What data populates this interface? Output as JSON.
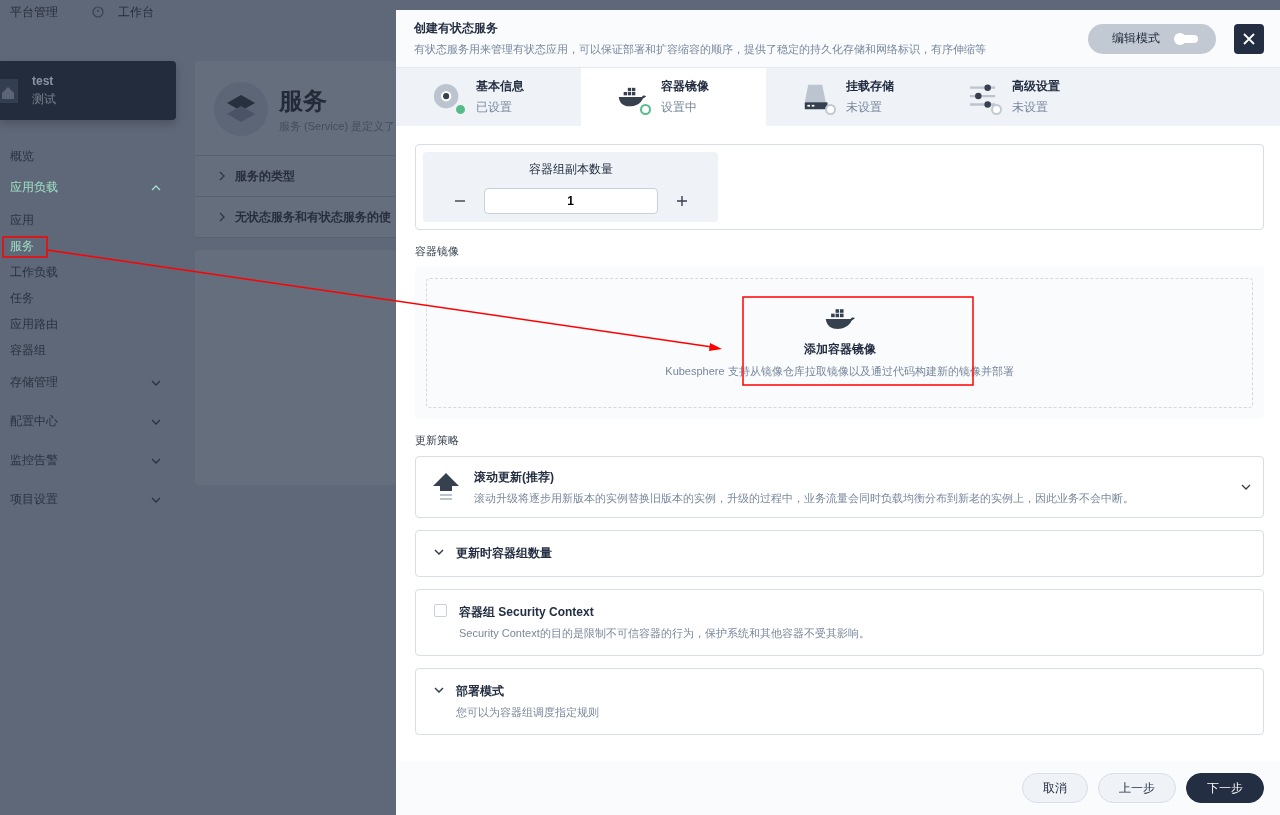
{
  "top_bar": {
    "items": [
      {
        "label": "平台管理",
        "kind": "text"
      },
      {
        "label": "工作台",
        "kind": "icon"
      }
    ]
  },
  "project": {
    "name": "test",
    "alias": "测试"
  },
  "nav": [
    {
      "label": "概览",
      "kind": "item",
      "selected": false
    },
    {
      "label": "应用负载",
      "kind": "group",
      "expanded": true,
      "selected": true,
      "children": [
        {
          "label": "应用",
          "selected": false
        },
        {
          "label": "服务",
          "selected": true
        },
        {
          "label": "工作负载",
          "selected": false
        },
        {
          "label": "任务",
          "selected": false
        },
        {
          "label": "应用路由",
          "selected": false
        },
        {
          "label": "容器组",
          "selected": false
        }
      ]
    },
    {
      "label": "存储管理",
      "kind": "group",
      "expanded": false,
      "selected": false
    },
    {
      "label": "配置中心",
      "kind": "group",
      "expanded": false,
      "selected": false
    },
    {
      "label": "监控告警",
      "kind": "group",
      "expanded": false,
      "selected": false
    },
    {
      "label": "项目设置",
      "kind": "group",
      "expanded": false,
      "selected": false
    }
  ],
  "page": {
    "title": "服务",
    "subtitle": "服务 (Service) 是定义了",
    "sections": [
      "服务的类型",
      "无状态服务和有状态服务的使"
    ]
  },
  "modal": {
    "title": "创建有状态服务",
    "description": "有状态服务用来管理有状态应用，可以保证部署和扩容缩容的顺序，提供了稳定的持久化存储和网络标识，有序伸缩等",
    "edit_mode": {
      "label": "编辑模式",
      "on": false
    },
    "tabs": [
      {
        "label": "基本信息",
        "status": "已设置",
        "kind": "info",
        "completed": true,
        "selected": false
      },
      {
        "label": "容器镜像",
        "status": "设置中",
        "kind": "image",
        "completed": false,
        "selected": true
      },
      {
        "label": "挂载存储",
        "status": "未设置",
        "kind": "storage",
        "completed": false,
        "selected": false
      },
      {
        "label": "高级设置",
        "status": "未设置",
        "kind": "advanced",
        "completed": false,
        "selected": false
      }
    ],
    "replicas": {
      "label": "容器组副本数量",
      "value": "1"
    },
    "image_section": {
      "label": "容器镜像",
      "add_title": "添加容器镜像",
      "add_hint": "Kubesphere 支持从镜像仓库拉取镜像以及通过代码构建新的镜像并部署"
    },
    "update_strategy": {
      "label": "更新策略",
      "title": "滚动更新(推荐)",
      "description": "滚动升级将逐步用新版本的实例替换旧版本的实例，升级的过程中，业务流量会同时负载均衡分布到新老的实例上，因此业务不会中断。"
    },
    "panels": [
      {
        "kind": "collapsible",
        "title": "更新时容器组数量",
        "expanded": false
      },
      {
        "kind": "checkbox",
        "title": "容器组 Security Context",
        "description": "Security Context的目的是限制不可信容器的行为，保护系统和其他容器不受其影响。",
        "checked": false
      },
      {
        "kind": "collapsible",
        "title": "部署模式",
        "description": "您可以为容器组调度指定规则",
        "expanded": false
      }
    ],
    "buttons": [
      {
        "label": "取消",
        "kind": "secondary"
      },
      {
        "label": "上一步",
        "kind": "secondary"
      },
      {
        "label": "下一步",
        "kind": "primary"
      }
    ]
  }
}
